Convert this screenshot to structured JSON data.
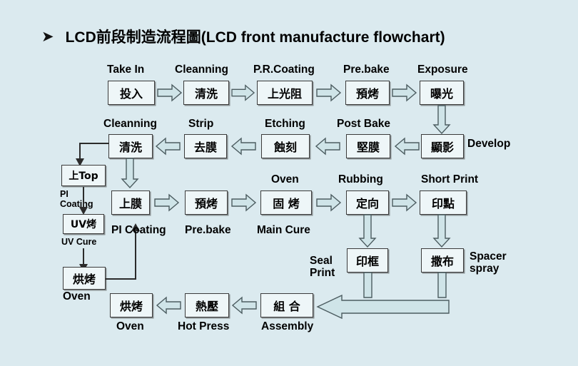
{
  "page": {
    "background_color": "#dbeaef",
    "box_fill": "#eef6f8",
    "arrow_fill": "#cfe4e8",
    "line_color": "#2b2b2b"
  },
  "header": {
    "bullet": "➤",
    "title": "LCD前段制造流程圖(LCD front manufacture flowchart)"
  },
  "row1": {
    "labels": [
      "Take In",
      "Cleanning",
      "P.R.Coating",
      "Pre.bake",
      "Exposure"
    ],
    "boxes": [
      "投入",
      "清洗",
      "上光阻",
      "預烤",
      "曝光"
    ]
  },
  "row2": {
    "labels": [
      "Cleanning",
      "Strip",
      "Etching",
      "Post Bake",
      "Develop"
    ],
    "boxes": [
      "清洗",
      "去膜",
      "蝕刻",
      "堅膜",
      "顯影"
    ]
  },
  "leftcol": {
    "box_top": "上Top",
    "label_top": "PI\nCoating",
    "box_uv": "UV烤",
    "label_uv": "UV Cure",
    "box_oven": "烘烤",
    "label_oven": "Oven"
  },
  "row3": {
    "labels": [
      "PI Coating",
      "Pre.bake",
      "Main Cure",
      "Rubbing",
      "Short Print"
    ],
    "label_oven": "Oven",
    "boxes": [
      "上膜",
      "預烤",
      "固 烤",
      "定向",
      "印點"
    ]
  },
  "row4": {
    "seal_label": "Seal\nPrint",
    "seal_box": "印框",
    "spacer_label": "Spacer\nspray",
    "spacer_box": "撒布"
  },
  "row5": {
    "labels": [
      "Oven",
      "Hot Press",
      "Assembly"
    ],
    "boxes": [
      "烘烤",
      "熱壓",
      "組 合"
    ]
  },
  "icons": {
    "arrow_right": "block-arrow-right-icon",
    "arrow_left": "block-arrow-left-icon",
    "arrow_down": "block-arrow-down-icon",
    "arrow_left_wide": "block-arrow-left-wide-icon",
    "connector": "connector-line-icon"
  }
}
